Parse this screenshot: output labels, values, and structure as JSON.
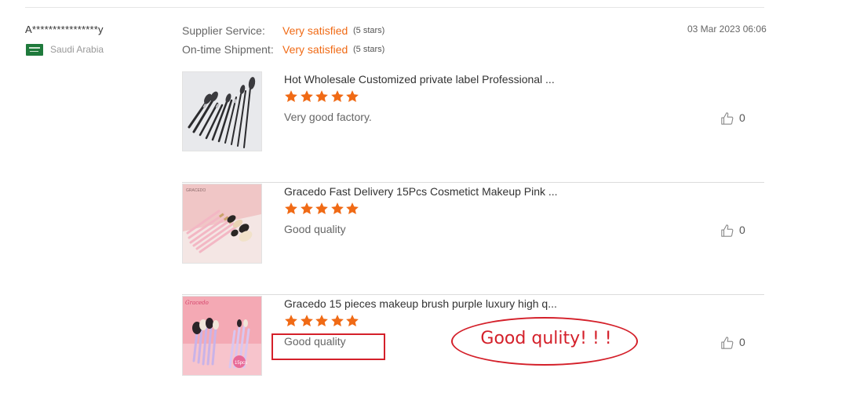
{
  "buyer": {
    "name": "A****************y",
    "country": "Saudi Arabia",
    "flag_icon": "saudi-arabia-flag-icon"
  },
  "ratings": [
    {
      "label": "Supplier Service:",
      "value": "Very satisfied",
      "stars_text": "(5 stars)"
    },
    {
      "label": "On-time Shipment:",
      "value": "Very satisfied",
      "stars_text": "(5 stars)"
    }
  ],
  "date": "03 Mar 2023 06:06",
  "reviews": [
    {
      "title": "Hot Wholesale Customized private label Professional ...",
      "rating": 5,
      "comment": "Very good factory.",
      "likes": "0"
    },
    {
      "title": "Gracedo Fast Delivery 15Pcs Cosmetict Makeup Pink ...",
      "rating": 5,
      "comment": "Good quality",
      "likes": "0",
      "thumb_brand": "GRACEDO"
    },
    {
      "title": "Gracedo 15 pieces makeup brush purple luxury high q...",
      "rating": 5,
      "comment": "Good quality",
      "likes": "0",
      "thumb_brand": "Gracedo",
      "thumb_badge": "15pcs"
    }
  ],
  "annotation": {
    "callout_text": "Good qulity! ! !"
  },
  "colors": {
    "accent_orange": "#f06a15",
    "annotation_red": "#d4202a",
    "divider": "#dcdcdc"
  }
}
